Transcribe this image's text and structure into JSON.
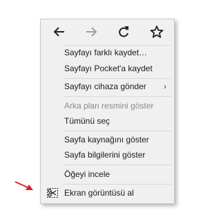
{
  "nav": {
    "back_icon": "arrow-left-icon",
    "forward_icon": "arrow-right-icon",
    "reload_icon": "reload-icon",
    "bookmark_icon": "star-icon"
  },
  "menu": {
    "save_page_as": "Sayfayı farklı kaydet…",
    "save_to_pocket": "Sayfayı Pocket'a kaydet",
    "send_page_to_device": "Sayfayı cihaza gönder",
    "send_page_chevron": "›",
    "view_background_image": "Arka plan resmini göster",
    "select_all": "Tümünü seç",
    "view_page_source": "Sayfa kaynağını göster",
    "view_page_info": "Sayfa bilgilerini göster",
    "inspect_element": "Öğeyi incele",
    "take_screenshot": "Ekran görüntüsü al",
    "screenshot_icon": "scissors-screenshot-icon"
  },
  "colors": {
    "menu_background": "#f0f0f0",
    "disabled_text": "#8a8a8a",
    "pointer_arrow": "#e02020"
  }
}
